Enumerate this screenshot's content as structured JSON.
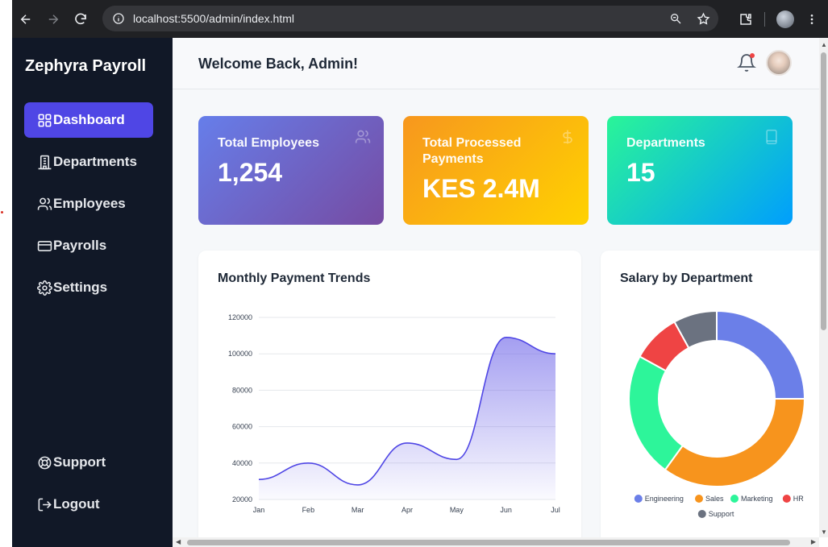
{
  "browser": {
    "url": "localhost:5500/admin/index.html"
  },
  "sidebar": {
    "brand": "Zephyra Payroll",
    "items": [
      {
        "label": "Dashboard",
        "icon": "grid-icon",
        "active": true
      },
      {
        "label": "Departments",
        "icon": "building-icon",
        "active": false
      },
      {
        "label": "Employees",
        "icon": "users-icon",
        "active": false
      },
      {
        "label": "Payrolls",
        "icon": "credit-card-icon",
        "active": false
      },
      {
        "label": "Settings",
        "icon": "gear-icon",
        "active": false
      }
    ],
    "bottom_items": [
      {
        "label": "Support",
        "icon": "lifebuoy-icon"
      },
      {
        "label": "Logout",
        "icon": "logout-icon"
      }
    ]
  },
  "header": {
    "welcome": "Welcome Back, Admin!"
  },
  "stats": [
    {
      "label": "Total Employees",
      "value": "1,254",
      "icon": "users-icon"
    },
    {
      "label": "Total Processed Payments",
      "value": "KES 2.4M",
      "icon": "dollar-icon"
    },
    {
      "label": "Departments",
      "value": "15",
      "icon": "building-icon"
    }
  ],
  "colors": {
    "sidebar_bg": "#111827",
    "accent": "#4f46e5",
    "line": "#4f46e5"
  },
  "chart_data": [
    {
      "type": "area",
      "title": "Monthly Payment Trends",
      "x": [
        "Jan",
        "Feb",
        "Mar",
        "Apr",
        "May",
        "Jun",
        "Jul"
      ],
      "series": [
        {
          "values": [
            31000,
            40000,
            28000,
            51000,
            42000,
            109000,
            100000
          ]
        }
      ],
      "y_ticks": [
        20000,
        40000,
        60000,
        80000,
        100000,
        120000
      ],
      "ylim": [
        20000,
        120000
      ],
      "grid": true
    },
    {
      "type": "pie",
      "title": "Salary by Department",
      "labels": [
        "Engineering",
        "Sales",
        "Marketing",
        "HR",
        "Support"
      ],
      "values": [
        25,
        35,
        23,
        9,
        8
      ],
      "colors": [
        "#6b7fe8",
        "#f7941d",
        "#2df59a",
        "#ef4444",
        "#6b7280"
      ],
      "legend": "bottom"
    }
  ]
}
